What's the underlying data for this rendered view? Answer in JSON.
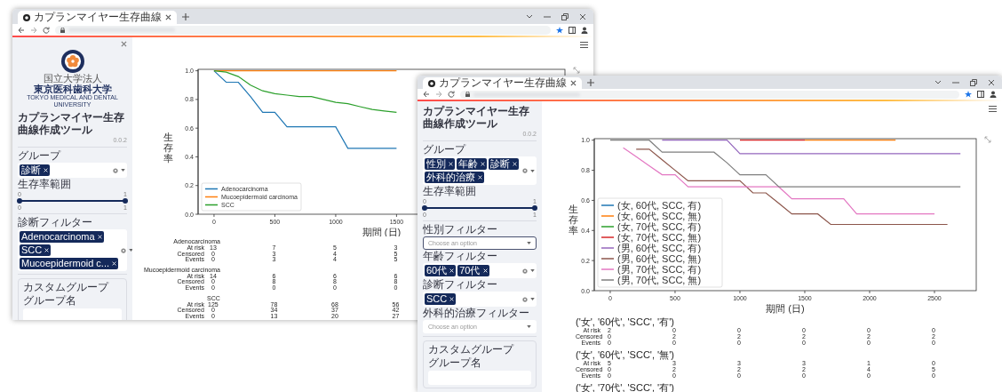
{
  "windows": [
    {
      "tab_title": "カプランマイヤー生存曲線",
      "sidebar": {
        "closable": true,
        "logo": {
          "org_type": "国立大学法人",
          "name": "東京医科歯科大学",
          "name_en": "TOKYO MEDICAL AND DENTAL UNIVERSITY"
        },
        "title": "カプランマイヤー生存曲線作成ツール",
        "version": "0.0.2",
        "controls": [
          {
            "kind": "divider"
          },
          {
            "kind": "multiselect",
            "label": "グループ",
            "chips": [
              "診断"
            ]
          },
          {
            "kind": "range",
            "label": "生存率範囲",
            "value_low": "0",
            "value_high": "1",
            "min": "0",
            "max": "1",
            "level": 1
          },
          {
            "kind": "divider"
          },
          {
            "kind": "multiselect",
            "label": "診断フィルター",
            "chips": [
              "Adenocarcinoma",
              "SCC",
              "Mucoepidermoid c..."
            ]
          },
          {
            "kind": "divider"
          }
        ],
        "custom_group": {
          "title": "カスタムグループ",
          "field_label": "グループ名"
        }
      },
      "chart_data": {
        "type": "line",
        "xlabel": "期間 (日)",
        "ylabel": "生存率",
        "x": [
          0,
          100,
          200,
          300,
          400,
          500,
          600,
          700,
          800,
          900,
          1000,
          1100,
          1200,
          1300,
          1400,
          1500
        ],
        "series": [
          {
            "name": "Adenocarcinoma",
            "color": "#1f77b4",
            "values": [
              1.0,
              0.92,
              0.92,
              0.82,
              0.71,
              0.71,
              0.61,
              0.61,
              0.61,
              0.61,
              0.61,
              0.46,
              0.46,
              0.46,
              0.46,
              0.46
            ]
          },
          {
            "name": "Mucoepidermoid carcinoma",
            "color": "#ff7f0e",
            "values": [
              1.0,
              1.0,
              1.0,
              1.0,
              1.0,
              1.0,
              1.0,
              1.0,
              1.0,
              1.0,
              1.0,
              1.0,
              1.0,
              1.0,
              1.0,
              1.0
            ]
          },
          {
            "name": "SCC",
            "color": "#2ca02c",
            "values": [
              1.0,
              0.99,
              0.96,
              0.9,
              0.86,
              0.84,
              0.83,
              0.82,
              0.82,
              0.8,
              0.78,
              0.77,
              0.75,
              0.73,
              0.72,
              0.71
            ]
          }
        ],
        "legend": "lower left",
        "xlim": [
          -131,
          2884
        ],
        "ylim": [
          0,
          1.01
        ],
        "xticks": [
          0,
          500,
          1000,
          1500
        ],
        "yticks": [
          {
            "value": 0,
            "label": "0.0"
          },
          {
            "value": 0.2,
            "label": "0.2"
          },
          {
            "value": 0.4,
            "label": "0.4"
          },
          {
            "value": 0.6,
            "label": "0.6"
          },
          {
            "value": 0.8,
            "label": "0.8"
          },
          {
            "value": 1.0,
            "label": "1.0"
          }
        ]
      },
      "risk_table": [
        {
          "group": "Adenocarcinoma",
          "rows": [
            {
              "label": "At risk",
              "values": [
                "13",
                "7",
                "5",
                "3"
              ]
            },
            {
              "label": "Censored",
              "values": [
                "0",
                "3",
                "4",
                "5"
              ]
            },
            {
              "label": "Events",
              "values": [
                "0",
                "3",
                "4",
                "5"
              ]
            }
          ]
        },
        {
          "group": "Mucoepidermoid carcinoma",
          "rows": [
            {
              "label": "At risk",
              "values": [
                "14",
                "6",
                "6",
                "6"
              ]
            },
            {
              "label": "Censored",
              "values": [
                "0",
                "8",
                "8",
                "8"
              ]
            },
            {
              "label": "Events",
              "values": [
                "0",
                "0",
                "0",
                "0"
              ]
            }
          ]
        },
        {
          "group": "SCC",
          "rows": [
            {
              "label": "At risk",
              "values": [
                "125",
                "78",
                "68",
                "56"
              ]
            },
            {
              "label": "Censored",
              "values": [
                "0",
                "34",
                "37",
                "42"
              ]
            },
            {
              "label": "Events",
              "values": [
                "0",
                "13",
                "20",
                "27"
              ]
            }
          ]
        }
      ]
    },
    {
      "tab_title": "カプランマイヤー生存曲線",
      "sidebar": {
        "title": "カプランマイヤー生存曲線作成ツール",
        "version": "0.0.2",
        "controls": [
          {
            "kind": "divider"
          },
          {
            "kind": "multiselect",
            "label": "グループ",
            "chips": [
              "性別",
              "年齢",
              "診断",
              "外科的治療"
            ]
          },
          {
            "kind": "range",
            "label": "生存率範囲",
            "value_low": "0",
            "value_high": "1",
            "min": "0",
            "max": "1",
            "level": 1
          },
          {
            "kind": "divider"
          },
          {
            "kind": "select",
            "label": "性別フィルター",
            "placeholder": "Choose an option",
            "focused": true
          },
          {
            "kind": "multiselect",
            "label": "年齢フィルター",
            "chips": [
              "60代",
              "70代"
            ]
          },
          {
            "kind": "multiselect",
            "label": "診断フィルター",
            "chips": [
              "SCC"
            ]
          },
          {
            "kind": "select",
            "label": "外科的治療フィルター",
            "placeholder": "Choose an option",
            "focused": false
          },
          {
            "kind": "divider"
          }
        ],
        "custom_group": {
          "title": "カスタムグループ",
          "field_label": "グループ名"
        }
      },
      "chart_data": {
        "type": "line",
        "xlabel": "期間 (日)",
        "ylabel": "生存率",
        "x": [
          0,
          100,
          200,
          300,
          400,
          500,
          600,
          700,
          800,
          900,
          1000,
          1100,
          1200,
          1300,
          1400,
          1500,
          1600,
          1700,
          1800,
          1900,
          2000,
          2100,
          2200,
          2300,
          2400,
          2500,
          2600,
          2700
        ],
        "series": [
          {
            "name": "(女, 60代, SCC, 有)",
            "color": "#1f77b4",
            "values": [
              null,
              null,
              null,
              null,
              null,
              null,
              null,
              null,
              null,
              null,
              null,
              null,
              null,
              null,
              null,
              null,
              null,
              null,
              null,
              null,
              null,
              null,
              null,
              null,
              null,
              null,
              null,
              null
            ]
          },
          {
            "name": "(女, 60代, SCC, 無)",
            "color": "#ff7f0e",
            "values": [
              null,
              null,
              null,
              null,
              null,
              null,
              null,
              null,
              null,
              null,
              null,
              null,
              null,
              null,
              null,
              1.0,
              1.0,
              1.0,
              1.0,
              1.0,
              1.0,
              1.0,
              1.0,
              null,
              null,
              null,
              null,
              null
            ]
          },
          {
            "name": "(女, 70代, SCC, 有)",
            "color": "#2ca02c",
            "values": [
              null,
              null,
              null,
              null,
              null,
              null,
              null,
              null,
              null,
              null,
              null,
              null,
              null,
              null,
              null,
              null,
              null,
              null,
              null,
              null,
              null,
              null,
              null,
              null,
              null,
              null,
              null,
              null
            ]
          },
          {
            "name": "(女, 70代, SCC, 無)",
            "color": "#d62728",
            "values": [
              null,
              null,
              null,
              null,
              null,
              null,
              null,
              null,
              null,
              null,
              1.0,
              1.0,
              1.0,
              1.0,
              1.0,
              1.0,
              null,
              null,
              null,
              null,
              null,
              null,
              null,
              null,
              null,
              null,
              null,
              null
            ]
          },
          {
            "name": "(男, 60代, SCC, 有)",
            "color": "#9467bd",
            "values": [
              null,
              null,
              null,
              null,
              1.0,
              1.0,
              1.0,
              1.0,
              1.0,
              1.0,
              0.91,
              0.91,
              0.91,
              0.91,
              0.91,
              0.91,
              0.91,
              0.91,
              0.91,
              0.91,
              0.91,
              0.91,
              0.91,
              0.91,
              0.91,
              0.91,
              0.91,
              0.91
            ]
          },
          {
            "name": "(男, 60代, SCC, 無)",
            "color": "#8c564b",
            "values": [
              null,
              null,
              0.94,
              0.94,
              0.87,
              0.8,
              0.73,
              0.73,
              0.73,
              0.73,
              0.73,
              0.65,
              0.65,
              0.58,
              0.51,
              0.51,
              0.51,
              0.44,
              0.44,
              0.44,
              0.44,
              0.44,
              0.44,
              0.44,
              0.44,
              0.44,
              0.44,
              null
            ]
          },
          {
            "name": "(男, 70代, SCC, 有)",
            "color": "#e377c2",
            "values": [
              null,
              0.95,
              0.89,
              0.83,
              0.77,
              0.77,
              0.69,
              0.69,
              0.69,
              0.69,
              0.69,
              0.69,
              0.69,
              0.69,
              0.61,
              0.61,
              0.61,
              0.61,
              0.61,
              0.51,
              0.51,
              0.51,
              0.51,
              0.51,
              0.51,
              0.51,
              null,
              null
            ]
          },
          {
            "name": "(男, 70代, SCC, 無)",
            "color": "#7f7f7f",
            "values": [
              1.0,
              1.0,
              1.0,
              1.0,
              0.92,
              0.92,
              0.92,
              0.92,
              0.92,
              0.85,
              0.77,
              0.77,
              0.77,
              0.69,
              0.69,
              0.69,
              0.69,
              0.69,
              0.69,
              0.69,
              0.69,
              0.69,
              0.69,
              0.69,
              0.69,
              0.69,
              0.69,
              0.69
            ]
          }
        ],
        "legend": "lower left",
        "xlim": [
          -123,
          2822
        ],
        "ylim": [
          0,
          1.01
        ],
        "xticks": [
          0,
          500,
          1000,
          1500,
          2000,
          2500
        ],
        "yticks": [
          {
            "value": 0,
            "label": "0.0"
          },
          {
            "value": 0.2,
            "label": "0.2"
          },
          {
            "value": 0.4,
            "label": "0.4"
          },
          {
            "value": 0.6,
            "label": "0.6"
          },
          {
            "value": 0.8,
            "label": "0.8"
          },
          {
            "value": 1.0,
            "label": "1.0"
          }
        ]
      },
      "risk_table": [
        {
          "group": "('女', '60代', 'SCC', '有')",
          "rows": [
            {
              "label": "At risk",
              "values": [
                "2",
                "0",
                "0",
                "0",
                "0",
                "0"
              ]
            },
            {
              "label": "Censored",
              "values": [
                "0",
                "2",
                "2",
                "2",
                "2",
                "2"
              ]
            },
            {
              "label": "Events",
              "values": [
                "0",
                "0",
                "0",
                "0",
                "0",
                "0"
              ]
            }
          ]
        },
        {
          "group": "('女', '60代', 'SCC', '無')",
          "rows": [
            {
              "label": "At risk",
              "values": [
                "5",
                "3",
                "3",
                "3",
                "1",
                "0"
              ]
            },
            {
              "label": "Censored",
              "values": [
                "0",
                "2",
                "2",
                "2",
                "4",
                "5"
              ]
            },
            {
              "label": "Events",
              "values": [
                "0",
                "0",
                "0",
                "0",
                "0",
                "0"
              ]
            }
          ]
        },
        {
          "group": "('女', '70代', 'SCC', '有')"
        }
      ]
    }
  ]
}
